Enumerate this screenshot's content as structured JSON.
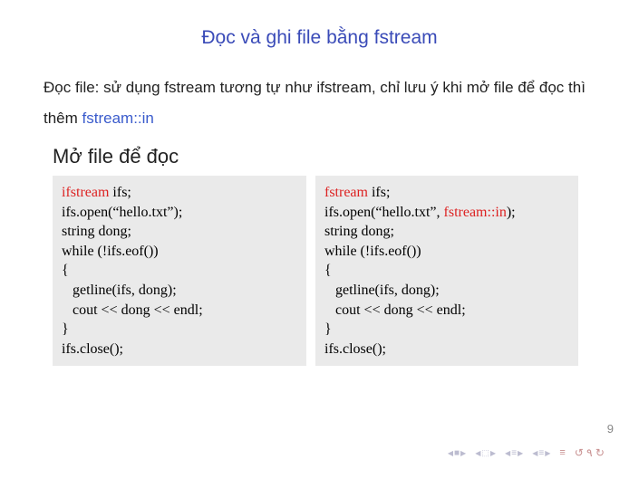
{
  "title": "Đọc và ghi file bằng fstream",
  "intro_parts": {
    "p1": "Đọc file: sử dụng fstream tương tự như ifstream, chỉ lưu ý khi mở file để đọc thì thêm ",
    "hl": "fstream::in"
  },
  "subtitle": "Mở file để đọc",
  "code_left": {
    "l1_kw": "ifstream",
    "l1_rest": " ifs;",
    "l2": "ifs.open(“hello.txt”);",
    "l3": "string dong;",
    "l4": "while (!ifs.eof())",
    "l5": "{",
    "l6": "   getline(ifs, dong);",
    "l7": "   cout << dong << endl;",
    "l8": "}",
    "l9": "ifs.close();"
  },
  "code_right": {
    "l1_kw": "fstream",
    "l1_rest": " ifs;",
    "l2_a": "ifs.open(“hello.txt”, ",
    "l2_kw": "fstream::in",
    "l2_b": ");",
    "l3": "string dong;",
    "l4": "while (!ifs.eof())",
    "l5": "{",
    "l6": "   getline(ifs, dong);",
    "l7": "   cout << dong << endl;",
    "l8": "}",
    "l9": "ifs.close();"
  },
  "nav": {
    "square": "■",
    "doc": "⬜",
    "tri_l": "◀",
    "tri_r": "▶",
    "eq": "≡",
    "loop1": "↺",
    "loop2": "↗",
    "loop3": "↻"
  },
  "page_number": "9"
}
